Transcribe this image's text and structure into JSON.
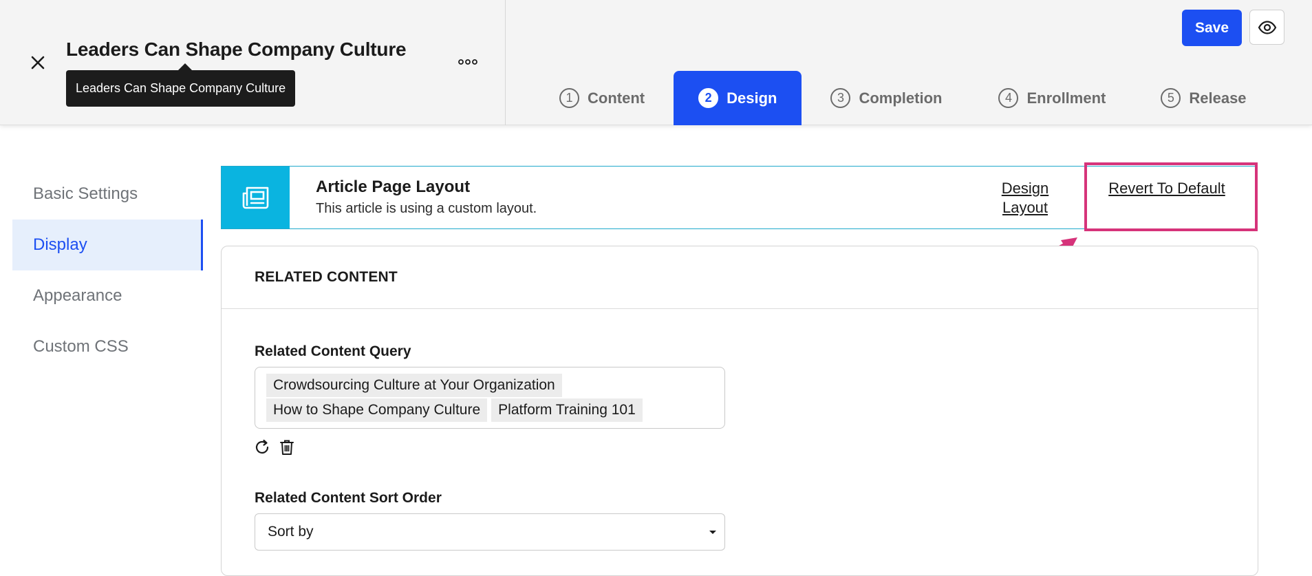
{
  "header": {
    "title": "Leaders Can Shape Company Culture",
    "tooltip": "Leaders Can Shape Company Culture",
    "close_icon": "close-icon",
    "more_icon": "more-horizontal-icon",
    "save_label": "Save",
    "preview_icon": "eye-icon"
  },
  "tabs": [
    {
      "num": "1",
      "label": "Content",
      "active": false
    },
    {
      "num": "2",
      "label": "Design",
      "active": true
    },
    {
      "num": "3",
      "label": "Completion",
      "active": false
    },
    {
      "num": "4",
      "label": "Enrollment",
      "active": false
    },
    {
      "num": "5",
      "label": "Release",
      "active": false
    }
  ],
  "sidebar": {
    "items": [
      {
        "label": "Basic Settings",
        "active": false
      },
      {
        "label": "Display",
        "active": true
      },
      {
        "label": "Appearance",
        "active": false
      },
      {
        "label": "Custom CSS",
        "active": false
      }
    ]
  },
  "banner": {
    "icon": "newspaper-icon",
    "title": "Article Page Layout",
    "subtitle": "This article is using a custom layout.",
    "design_link": "Design Layout",
    "revert_link": "Revert To Default"
  },
  "related": {
    "section_title": "RELATED CONTENT",
    "query_label": "Related Content Query",
    "query_chips": [
      "Crowdsourcing Culture at Your Organization",
      "How to Shape Company Culture",
      "Platform Training 101"
    ],
    "refresh_icon": "refresh-icon",
    "delete_icon": "trash-icon",
    "sort_label": "Related Content Sort Order",
    "sort_value": "Sort by"
  },
  "colors": {
    "accent": "#1c4ff2",
    "banner_icon_bg": "#0ab4e0",
    "highlight": "#d6337a"
  }
}
